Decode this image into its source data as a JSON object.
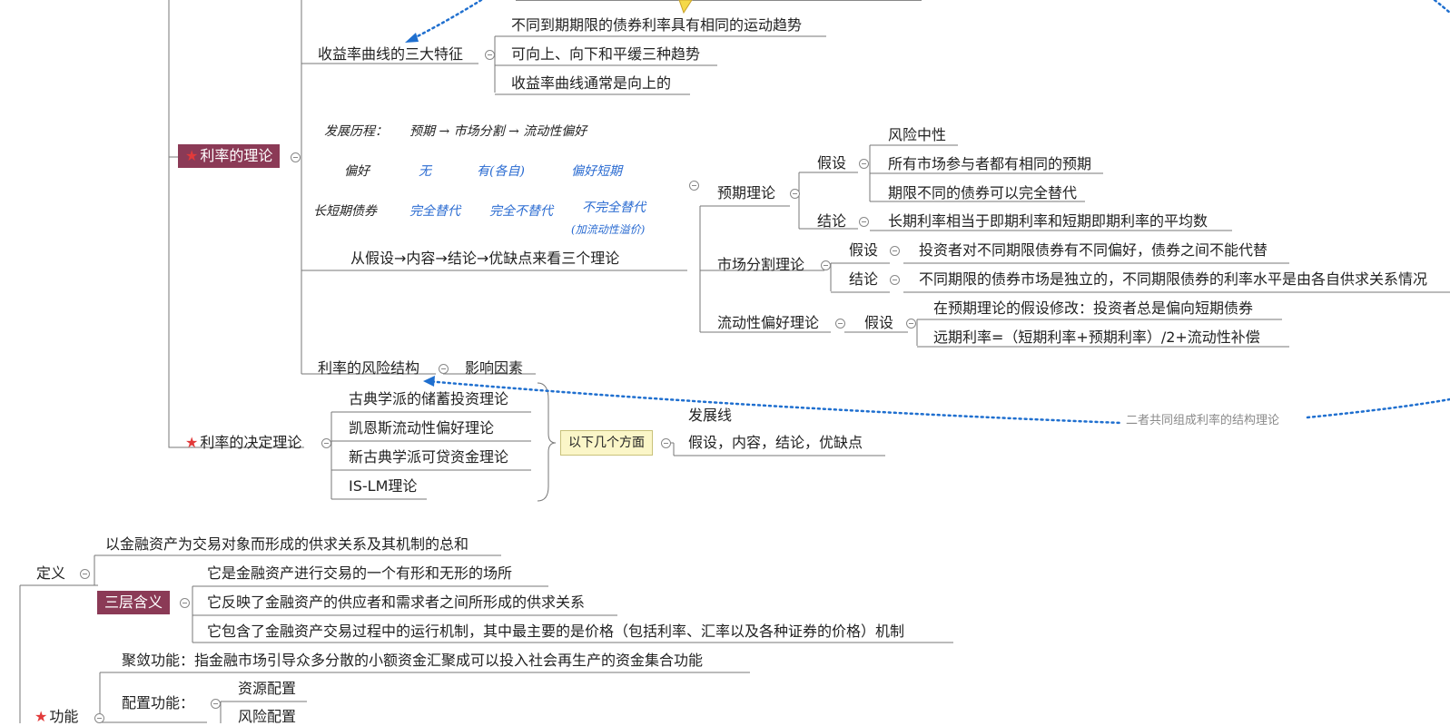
{
  "colors": {
    "tag_bg": "#8b3a56",
    "star": "#e23a3a",
    "relation_line": "#1f6fcf",
    "note_bg": "#fbf6c8",
    "line": "#777777"
  },
  "icons": {
    "collapse": "collapse-minus-icon",
    "star": "star-icon"
  },
  "theory": {
    "yield_curve": {
      "title": "收益率曲线的三大特征",
      "items": [
        "不同到期期限的债券利率具有相同的运动趋势",
        "可向上、向下和平缓三种趋势",
        "收益率曲线通常是向上的"
      ]
    },
    "handwritten": {
      "r1a": "发展历程：",
      "r1b": "预期 → 市场分割 → 流动性偏好",
      "r2a": "偏好",
      "r2b": "无",
      "r2c": "有(各自)",
      "r2d": "偏好短期",
      "r3a": "长短期债券",
      "r3b": "完全替代",
      "r3c": "完全不替代",
      "r3d": "不完全替代",
      "r3e": "(加流动性溢价)"
    },
    "three_theories": "从假设→内容→结论→优缺点来看三个理论",
    "tag_interest_theory": "利率的理论",
    "expectation": {
      "title": "预期理论",
      "assumption": "假设",
      "assumptions": [
        "风险中性",
        "所有市场参与者都有相同的预期",
        "期限不同的债券可以完全替代"
      ],
      "conclusion": "结论",
      "conclusion_text": "长期利率相当于即期利率和短期即期利率的平均数"
    },
    "segmentation": {
      "title": "市场分割理论",
      "assumption": "假设",
      "assumption_text": "投资者对不同期限债券有不同偏好，债券之间不能代替",
      "conclusion": "结论",
      "conclusion_text": "不同期限的债券市场是独立的，不同期限债券的利率水平是由各自供求关系情况"
    },
    "liquidity": {
      "title": "流动性偏好理论",
      "assumption": "假设",
      "items": [
        "在预期理论的假设修改：投资者总是偏向短期债券",
        "远期利率=（短期利率+预期利率）/2+流动性补偿"
      ]
    },
    "risk": {
      "title": "利率的风险结构",
      "factor": "影响因素"
    },
    "determination": {
      "title": "利率的决定理论",
      "items": [
        "古典学派的储蓄投资理论",
        "凯恩斯流动性偏好理论",
        "新古典学派可贷资金理论",
        "IS-LM理论"
      ],
      "note": "以下几个方面",
      "dev": "发展线",
      "aspects": "假设，内容，结论，优缺点"
    },
    "relation_label": "二者共同组成利率的结构理论"
  },
  "market": {
    "definition": "定义",
    "def_text": "以金融资产为交易对象而形成的供求关系及其机制的总和",
    "three_layers": "三层含义",
    "layers": [
      "它是金融资产进行交易的一个有形和无形的场所",
      "它反映了金融资产的供应者和需求者之间所形成的供求关系",
      "它包含了金融资产交易过程中的运行机制，其中最主要的是价格（包括利率、汇率以及各种证券的价格）机制"
    ],
    "function": "功能",
    "gather": "聚敛功能：指金融市场引导众多分散的小额资金汇聚成可以投入社会再生产的资金集合功能",
    "allocation": "配置功能：",
    "alloc_items": [
      "资源配置",
      "风险配置"
    ]
  }
}
